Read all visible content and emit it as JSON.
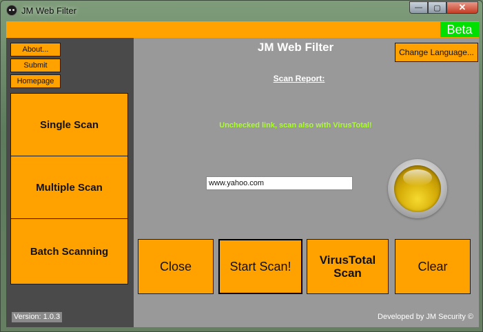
{
  "window": {
    "title": "JM Web Filter",
    "minimize_glyph": "—",
    "maximize_glyph": "▢",
    "close_glyph": "✕"
  },
  "top_bar": {
    "badge": "Beta"
  },
  "sidebar": {
    "small_buttons": [
      "About...",
      "Submit",
      "Homepage"
    ],
    "scan_modes": [
      "Single Scan",
      "Multiple Scan",
      "Batch Scanning"
    ],
    "version": "Version: 1.0.3"
  },
  "main": {
    "heading": "JM Web Filter",
    "change_language_label": "Change Language...",
    "scan_report_label": "Scan Report:",
    "status_message": "Unchecked link, scan also with VirusTotal!",
    "url_input_value": "www.yahoo.com",
    "indicator_status": "yellow",
    "actions": {
      "close": "Close",
      "start_scan": "Start Scan!",
      "virustotal_scan": "VirusTotal Scan",
      "clear": "Clear"
    },
    "credit": "Developed by JM Security ©"
  },
  "colors": {
    "accent_orange": "#ffa200",
    "beta_green": "#00e000",
    "status_green": "#aaff2a",
    "panel_gray": "#999999",
    "sidebar_dark": "#4a4a4a"
  }
}
